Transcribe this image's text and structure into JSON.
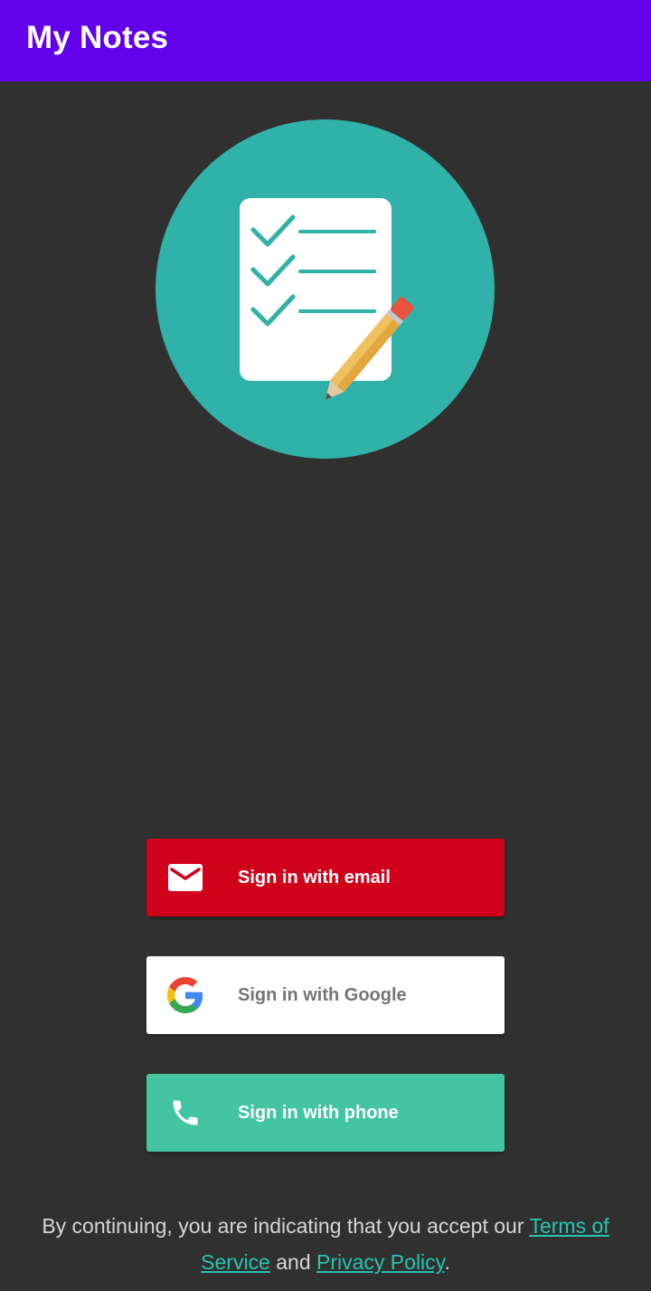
{
  "app_bar": {
    "title": "My Notes",
    "background": "#6200ea"
  },
  "logo": {
    "icon": "notes-checklist-pencil-icon",
    "circle_color": "#30b2a8"
  },
  "buttons": {
    "email": {
      "label": "Sign in with email",
      "icon": "mail-icon",
      "background": "#d0021b"
    },
    "google": {
      "label": "Sign in with Google",
      "icon": "google-logo-icon",
      "background": "#ffffff"
    },
    "phone": {
      "label": "Sign in with phone",
      "icon": "phone-icon",
      "background": "#43c5a2"
    }
  },
  "legal": {
    "prefix": "By continuing, you are indicating that you accept our ",
    "terms_label": "Terms of Service",
    "middle": " and ",
    "privacy_label": "Privacy Policy",
    "suffix": ".",
    "link_color": "#26c6b2"
  }
}
